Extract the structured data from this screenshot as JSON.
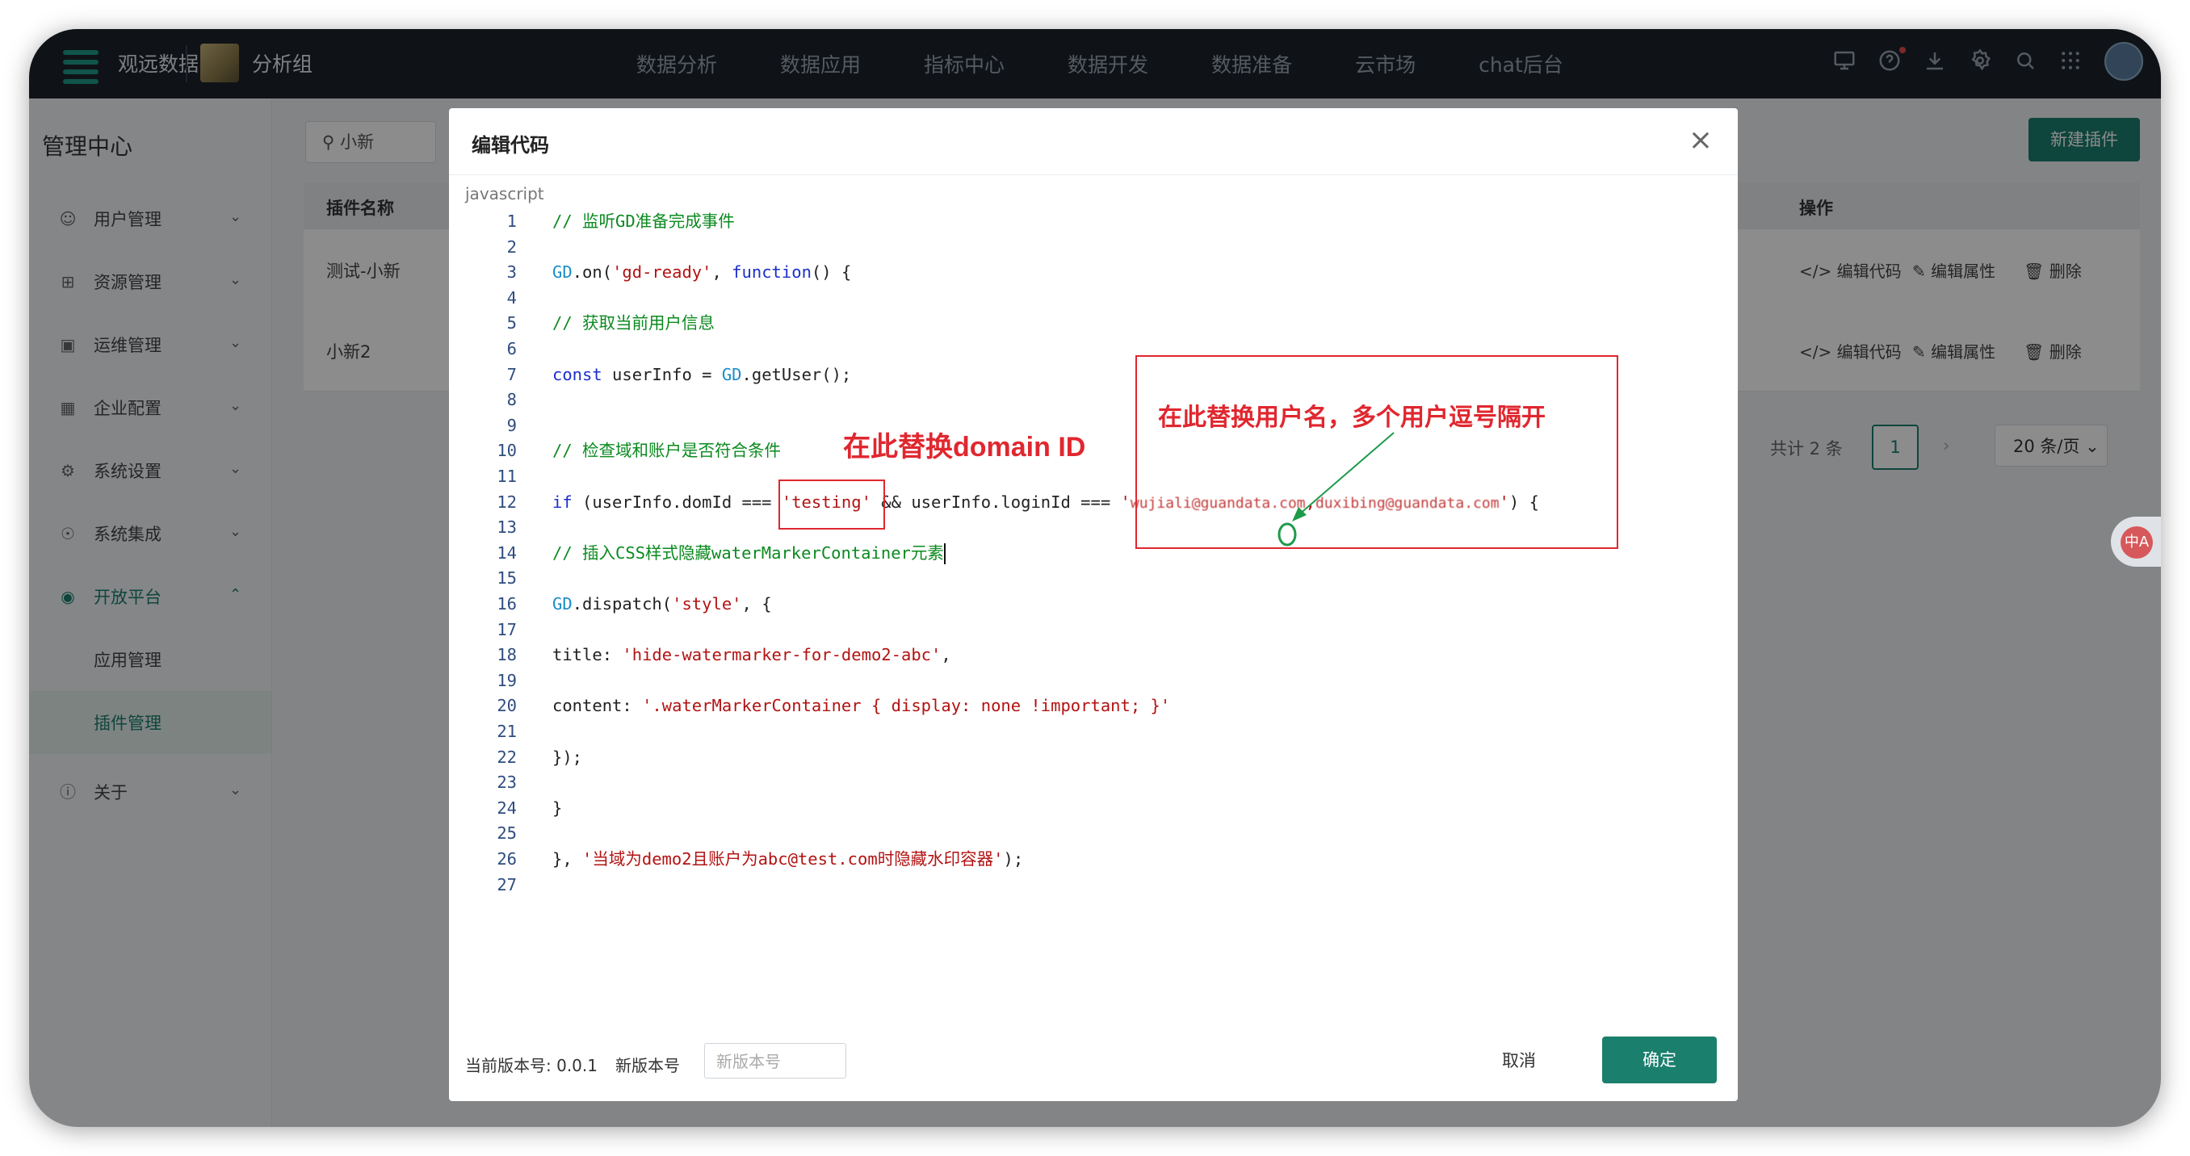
{
  "topbar": {
    "brand": "观远数据",
    "group": "分析组",
    "nav": [
      "数据分析",
      "数据应用",
      "指标中心",
      "数据开发",
      "数据准备",
      "云市场",
      "chat后台"
    ]
  },
  "sidebar": {
    "title": "管理中心",
    "items": [
      {
        "label": "用户管理",
        "icon": "user-icon"
      },
      {
        "label": "资源管理",
        "icon": "grid-icon"
      },
      {
        "label": "运维管理",
        "icon": "monitor-icon"
      },
      {
        "label": "企业配置",
        "icon": "building-icon"
      },
      {
        "label": "系统设置",
        "icon": "settings-icon"
      },
      {
        "label": "系统集成",
        "icon": "integration-icon"
      },
      {
        "label": "开放平台",
        "icon": "open-platform-icon"
      }
    ],
    "subitems": [
      "应用管理",
      "插件管理"
    ],
    "about": "关于"
  },
  "main": {
    "search_value": "小新",
    "new_button": "新建插件",
    "columns": {
      "name": "插件名称",
      "actions": "操作"
    },
    "rows": [
      {
        "name": "测试-小新"
      },
      {
        "name": "小新2"
      }
    ],
    "actions": {
      "edit_code": "编辑代码",
      "edit_props": "编辑属性",
      "delete": "删除"
    },
    "pagination": {
      "total": "共计 2 条",
      "current": "1",
      "page_size": "20 条/页"
    }
  },
  "modal": {
    "title": "编辑代码",
    "language": "javascript",
    "current_version_label": "当前版本号: 0.0.1",
    "new_version_label": "新版本号",
    "new_version_placeholder": "新版本号",
    "cancel": "取消",
    "confirm": "确定",
    "annotation_domain": "在此替换domain ID",
    "annotation_users": "在此替换用户名，多个用户逗号隔开",
    "code": {
      "l1": "// 监听GD准备完成事件",
      "l3_a": "GD",
      "l3_b": ".on(",
      "l3_c": "'gd-ready'",
      "l3_d": ", ",
      "l3_e": "function",
      "l3_f": "() {",
      "l5": "// 获取当前用户信息",
      "l7_a": "const",
      "l7_b": " userInfo = ",
      "l7_c": "GD",
      "l7_d": ".getUser();",
      "l10": "// 检查域和账户是否符合条件",
      "l12_a": "if",
      "l12_b": " (userInfo.domId === ",
      "l12_c": "'testing'",
      "l12_d": " && userInfo.loginId === ",
      "l12_e": "'",
      "l12_f": "wujiali@guandata.com",
      "l12_g": ",",
      "l12_h": "duxibing@guandata.com",
      "l12_i": "'",
      "l12_j": ") {",
      "l14": "// 插入CSS样式隐藏waterMarkerContainer元素",
      "l16_a": "GD",
      "l16_b": ".dispatch(",
      "l16_c": "'style'",
      "l16_d": ", {",
      "l18_a": "title: ",
      "l18_b": "'hide-watermarker-for-demo2-abc'",
      "l18_c": ",",
      "l20_a": "content: ",
      "l20_b": "'.waterMarkerContainer { display: none !important; }'",
      "l22": "});",
      "l24": "}",
      "l26_a": "}, ",
      "l26_b": "'当域为demo2且账户为abc@test.com时隐藏水印容器'",
      "l26_c": ");"
    }
  },
  "float_button": "中A"
}
